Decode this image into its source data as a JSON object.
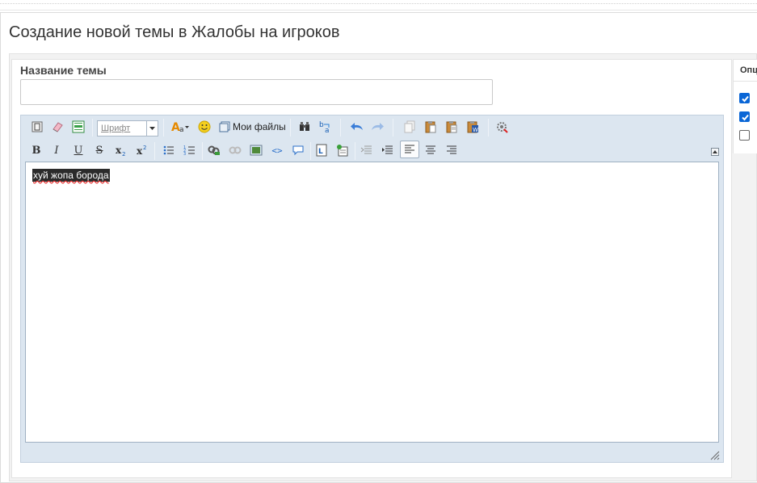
{
  "page": {
    "title": "Создание новой темы в Жалобы на игроков"
  },
  "form": {
    "title_label": "Название темы",
    "title_value": ""
  },
  "editor": {
    "font_select_value": "Шрифт",
    "my_files_label": "Мои файлы",
    "content_text": "хуй жопа борода",
    "toolbar_row1": [
      "source-icon",
      "eraser-icon",
      "toggle-wysiwyg-icon",
      "font-select",
      "text-color-icon",
      "smiley-icon",
      "my-files-icon",
      "find-icon",
      "replace-icon",
      "undo-icon",
      "redo-icon",
      "copy-icon",
      "paste-icon",
      "paste-text-icon",
      "paste-word-icon",
      "settings-icon"
    ],
    "toolbar_row2": [
      "bold-icon",
      "italic-icon",
      "underline-icon",
      "strikethrough-icon",
      "subscript-icon",
      "superscript-icon",
      "bulleted-list-icon",
      "numbered-list-icon",
      "link-icon",
      "unlink-icon",
      "image-icon",
      "code-icon",
      "quote-icon",
      "table-icon",
      "insert-icon",
      "outdent-icon",
      "indent-icon",
      "align-left-icon",
      "align-center-icon",
      "align-right-icon"
    ]
  },
  "options": {
    "header": "Опции",
    "checkboxes": [
      {
        "checked": true
      },
      {
        "checked": true
      },
      {
        "checked": false
      }
    ]
  },
  "colors": {
    "editor_bg": "#dce6f0",
    "checkbox_on": "#0a66d6"
  }
}
